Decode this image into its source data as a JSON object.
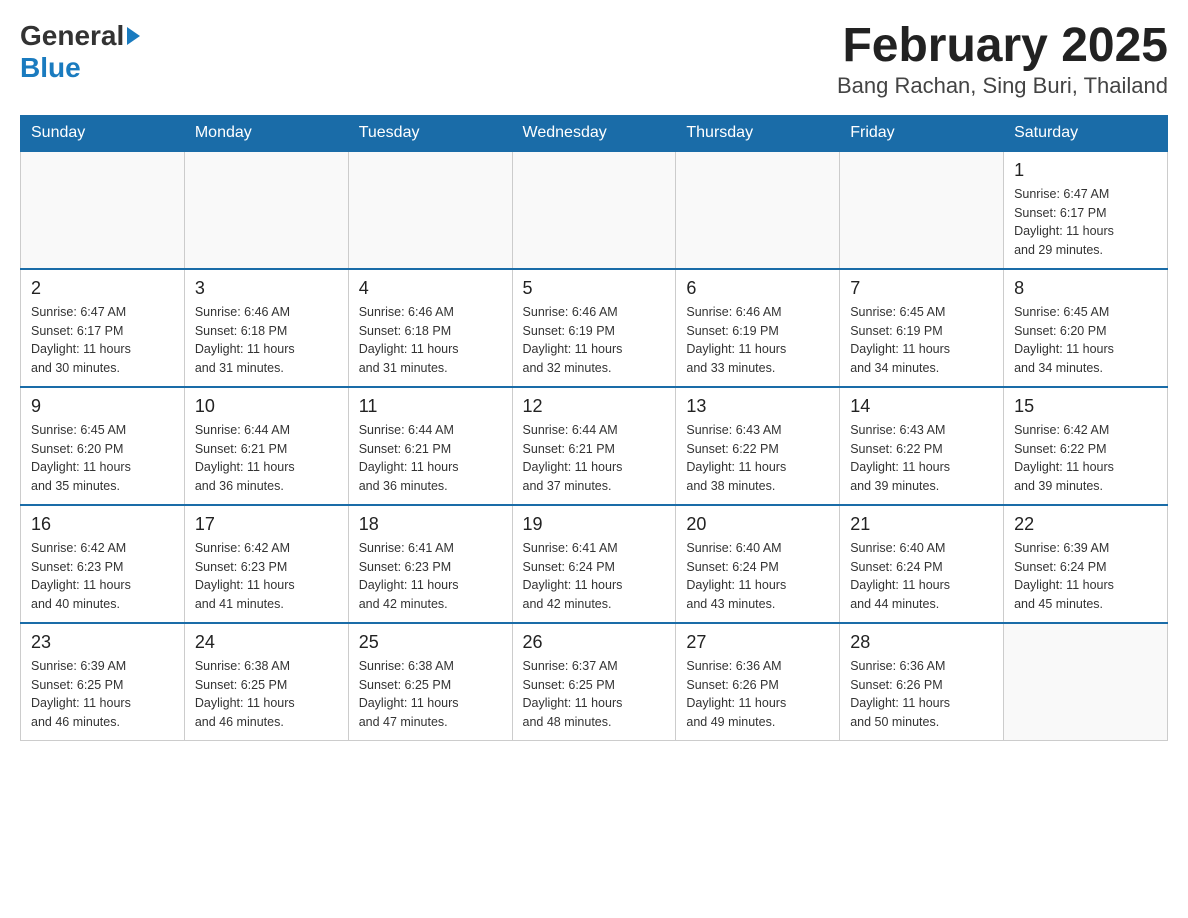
{
  "header": {
    "logo_general": "General",
    "logo_blue": "Blue",
    "title": "February 2025",
    "subtitle": "Bang Rachan, Sing Buri, Thailand"
  },
  "weekdays": [
    "Sunday",
    "Monday",
    "Tuesday",
    "Wednesday",
    "Thursday",
    "Friday",
    "Saturday"
  ],
  "weeks": [
    [
      {
        "day": "",
        "info": ""
      },
      {
        "day": "",
        "info": ""
      },
      {
        "day": "",
        "info": ""
      },
      {
        "day": "",
        "info": ""
      },
      {
        "day": "",
        "info": ""
      },
      {
        "day": "",
        "info": ""
      },
      {
        "day": "1",
        "info": "Sunrise: 6:47 AM\nSunset: 6:17 PM\nDaylight: 11 hours\nand 29 minutes."
      }
    ],
    [
      {
        "day": "2",
        "info": "Sunrise: 6:47 AM\nSunset: 6:17 PM\nDaylight: 11 hours\nand 30 minutes."
      },
      {
        "day": "3",
        "info": "Sunrise: 6:46 AM\nSunset: 6:18 PM\nDaylight: 11 hours\nand 31 minutes."
      },
      {
        "day": "4",
        "info": "Sunrise: 6:46 AM\nSunset: 6:18 PM\nDaylight: 11 hours\nand 31 minutes."
      },
      {
        "day": "5",
        "info": "Sunrise: 6:46 AM\nSunset: 6:19 PM\nDaylight: 11 hours\nand 32 minutes."
      },
      {
        "day": "6",
        "info": "Sunrise: 6:46 AM\nSunset: 6:19 PM\nDaylight: 11 hours\nand 33 minutes."
      },
      {
        "day": "7",
        "info": "Sunrise: 6:45 AM\nSunset: 6:19 PM\nDaylight: 11 hours\nand 34 minutes."
      },
      {
        "day": "8",
        "info": "Sunrise: 6:45 AM\nSunset: 6:20 PM\nDaylight: 11 hours\nand 34 minutes."
      }
    ],
    [
      {
        "day": "9",
        "info": "Sunrise: 6:45 AM\nSunset: 6:20 PM\nDaylight: 11 hours\nand 35 minutes."
      },
      {
        "day": "10",
        "info": "Sunrise: 6:44 AM\nSunset: 6:21 PM\nDaylight: 11 hours\nand 36 minutes."
      },
      {
        "day": "11",
        "info": "Sunrise: 6:44 AM\nSunset: 6:21 PM\nDaylight: 11 hours\nand 36 minutes."
      },
      {
        "day": "12",
        "info": "Sunrise: 6:44 AM\nSunset: 6:21 PM\nDaylight: 11 hours\nand 37 minutes."
      },
      {
        "day": "13",
        "info": "Sunrise: 6:43 AM\nSunset: 6:22 PM\nDaylight: 11 hours\nand 38 minutes."
      },
      {
        "day": "14",
        "info": "Sunrise: 6:43 AM\nSunset: 6:22 PM\nDaylight: 11 hours\nand 39 minutes."
      },
      {
        "day": "15",
        "info": "Sunrise: 6:42 AM\nSunset: 6:22 PM\nDaylight: 11 hours\nand 39 minutes."
      }
    ],
    [
      {
        "day": "16",
        "info": "Sunrise: 6:42 AM\nSunset: 6:23 PM\nDaylight: 11 hours\nand 40 minutes."
      },
      {
        "day": "17",
        "info": "Sunrise: 6:42 AM\nSunset: 6:23 PM\nDaylight: 11 hours\nand 41 minutes."
      },
      {
        "day": "18",
        "info": "Sunrise: 6:41 AM\nSunset: 6:23 PM\nDaylight: 11 hours\nand 42 minutes."
      },
      {
        "day": "19",
        "info": "Sunrise: 6:41 AM\nSunset: 6:24 PM\nDaylight: 11 hours\nand 42 minutes."
      },
      {
        "day": "20",
        "info": "Sunrise: 6:40 AM\nSunset: 6:24 PM\nDaylight: 11 hours\nand 43 minutes."
      },
      {
        "day": "21",
        "info": "Sunrise: 6:40 AM\nSunset: 6:24 PM\nDaylight: 11 hours\nand 44 minutes."
      },
      {
        "day": "22",
        "info": "Sunrise: 6:39 AM\nSunset: 6:24 PM\nDaylight: 11 hours\nand 45 minutes."
      }
    ],
    [
      {
        "day": "23",
        "info": "Sunrise: 6:39 AM\nSunset: 6:25 PM\nDaylight: 11 hours\nand 46 minutes."
      },
      {
        "day": "24",
        "info": "Sunrise: 6:38 AM\nSunset: 6:25 PM\nDaylight: 11 hours\nand 46 minutes."
      },
      {
        "day": "25",
        "info": "Sunrise: 6:38 AM\nSunset: 6:25 PM\nDaylight: 11 hours\nand 47 minutes."
      },
      {
        "day": "26",
        "info": "Sunrise: 6:37 AM\nSunset: 6:25 PM\nDaylight: 11 hours\nand 48 minutes."
      },
      {
        "day": "27",
        "info": "Sunrise: 6:36 AM\nSunset: 6:26 PM\nDaylight: 11 hours\nand 49 minutes."
      },
      {
        "day": "28",
        "info": "Sunrise: 6:36 AM\nSunset: 6:26 PM\nDaylight: 11 hours\nand 50 minutes."
      },
      {
        "day": "",
        "info": ""
      }
    ]
  ]
}
